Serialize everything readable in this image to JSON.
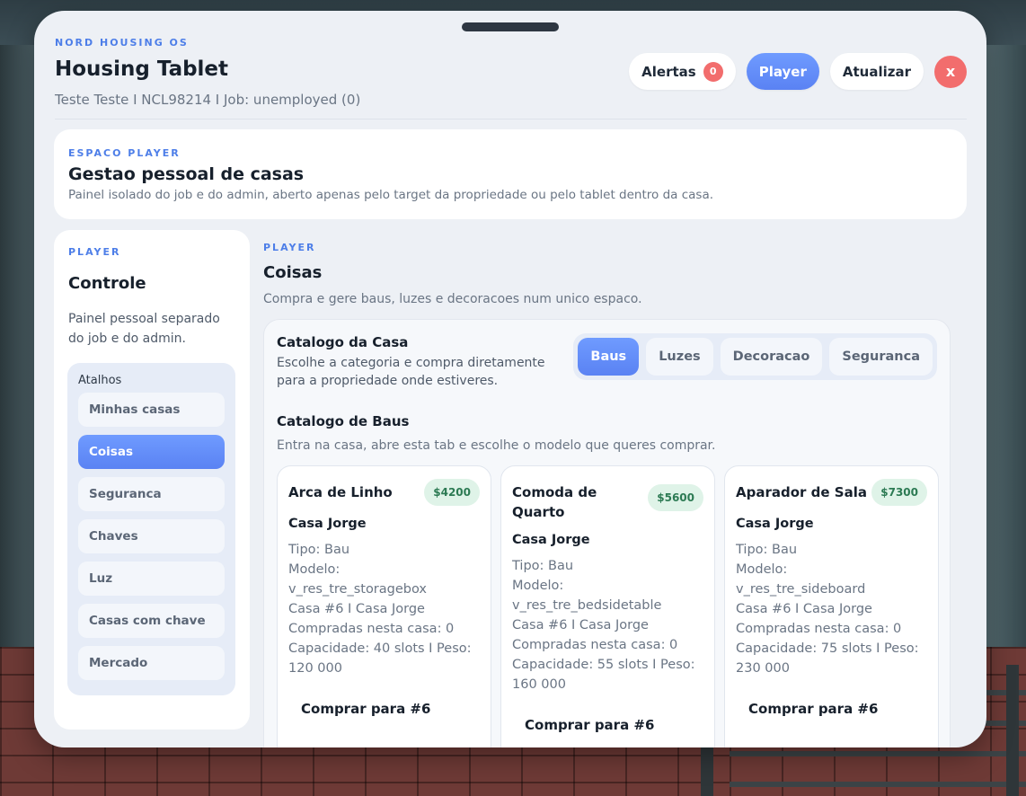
{
  "header": {
    "brand": "NORD HOUSING OS",
    "title": "Housing Tablet",
    "subtitle": "Teste Teste I NCL98214 I Job: unemployed (0)",
    "alerts_label": "Alertas",
    "alerts_count": "0",
    "player_label": "Player",
    "refresh_label": "Atualizar",
    "close_label": "x"
  },
  "space": {
    "eyebrow": "ESPACO PLAYER",
    "title": "Gestao pessoal de casas",
    "description": "Painel isolado do job e do admin, aberto apenas pelo target da propriedade ou pelo tablet dentro da casa."
  },
  "sidebar": {
    "eyebrow": "PLAYER",
    "title": "Controle",
    "description": "Painel pessoal separado do job e do admin.",
    "shortcuts_label": "Atalhos",
    "items": [
      {
        "label": "Minhas casas",
        "active": false
      },
      {
        "label": "Coisas",
        "active": true
      },
      {
        "label": "Seguranca",
        "active": false
      },
      {
        "label": "Chaves",
        "active": false
      },
      {
        "label": "Luz",
        "active": false
      },
      {
        "label": "Casas com chave",
        "active": false
      },
      {
        "label": "Mercado",
        "active": false
      }
    ]
  },
  "main": {
    "eyebrow": "PLAYER",
    "title": "Coisas",
    "description": "Compra e gere baus, luzes e decoracoes num unico espaco.",
    "catalog": {
      "title": "Catalogo da Casa",
      "description": "Escolhe a categoria e compra diretamente para a propriedade onde estiveres.",
      "tabs": [
        {
          "label": "Baus",
          "active": true
        },
        {
          "label": "Luzes",
          "active": false
        },
        {
          "label": "Decoracao",
          "active": false
        },
        {
          "label": "Seguranca",
          "active": false
        }
      ],
      "section_title": "Catalogo de Baus",
      "section_description": "Entra na casa, abre esta tab e escolhe o modelo que queres comprar.",
      "items": [
        {
          "name": "Arca de Linho",
          "price": "$4200",
          "house": "Casa Jorge",
          "type": "Tipo: Bau",
          "model_label": "Modelo:",
          "model": "v_res_tre_storagebox",
          "location": "Casa #6 I Casa Jorge",
          "bought": "Compradas nesta casa: 0",
          "capacity": "Capacidade: 40 slots I Peso:",
          "weight": "120 000",
          "buy_label": "Comprar para #6"
        },
        {
          "name": "Comoda de Quarto",
          "price": "$5600",
          "house": "Casa Jorge",
          "type": "Tipo: Bau",
          "model_label": "Modelo:",
          "model": "v_res_tre_bedsidetable",
          "location": "Casa #6 I Casa Jorge",
          "bought": "Compradas nesta casa: 0",
          "capacity": "Capacidade: 55 slots I Peso:",
          "weight": "160 000",
          "buy_label": "Comprar para #6"
        },
        {
          "name": "Aparador de Sala",
          "price": "$7300",
          "house": "Casa Jorge",
          "type": "Tipo: Bau",
          "model_label": "Modelo:",
          "model": "v_res_tre_sideboard",
          "location": "Casa #6 I Casa Jorge",
          "bought": "Compradas nesta casa: 0",
          "capacity": "Capacidade: 75 slots I Peso:",
          "weight": "230 000",
          "buy_label": "Comprar para #6"
        }
      ]
    }
  },
  "colors": {
    "accent": "#5a82f3",
    "danger": "#f26d6d",
    "price_bg": "#dff3e8",
    "price_text": "#2c7a53"
  }
}
